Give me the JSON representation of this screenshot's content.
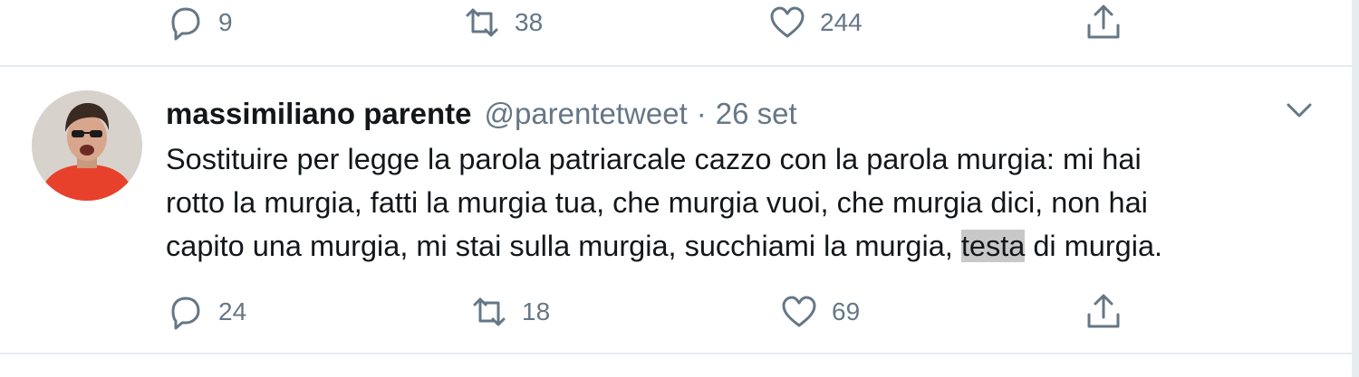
{
  "previous_tweet": {
    "actions": {
      "reply": {
        "icon": "reply-icon",
        "count": "9"
      },
      "retweet": {
        "icon": "retweet-icon",
        "count": "38"
      },
      "like": {
        "icon": "heart-icon",
        "count": "244"
      },
      "share": {
        "icon": "share-icon"
      }
    }
  },
  "tweet": {
    "display_name": "massimiliano parente",
    "handle": "@parentetweet",
    "separator": "·",
    "date": "26 set",
    "text_lines": [
      "Sostituire per legge la parola patriarcale cazzo con la parola murgia: mi hai",
      "rotto la murgia, fatti la murgia tua, che murgia vuoi, che murgia dici, non hai"
    ],
    "last_line_before": "capito una murgia, mi stai sulla murgia, succhiami la murgia, ",
    "last_line_highlighted": "testa",
    "last_line_after": " di murgia.",
    "actions": {
      "reply": {
        "icon": "reply-icon",
        "count": "24"
      },
      "retweet": {
        "icon": "retweet-icon",
        "count": "18"
      },
      "like": {
        "icon": "heart-icon",
        "count": "69"
      },
      "share": {
        "icon": "share-icon"
      }
    }
  },
  "colors": {
    "text": "#14171a",
    "secondary": "#657786",
    "divider": "#e6ecf0",
    "highlight": "#c8c8c8",
    "avatar_shirt": "#e8412b"
  }
}
